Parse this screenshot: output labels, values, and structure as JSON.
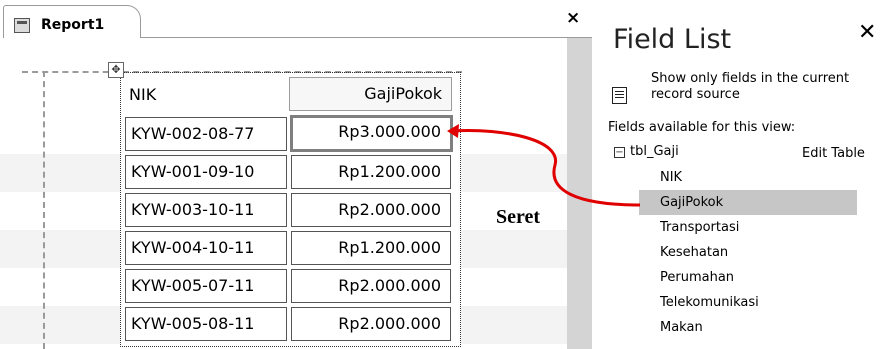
{
  "report_window": {
    "tab_label": "Report1",
    "close_glyph": "×",
    "move_handle_glyph": "✥",
    "columns": {
      "left_header": "NIK",
      "right_header": "GajiPokok"
    },
    "rows": [
      {
        "nik": "KYW-002-08-77",
        "gaji": "Rp3.000.000"
      },
      {
        "nik": "KYW-001-09-10",
        "gaji": "Rp1.200.000"
      },
      {
        "nik": "KYW-003-10-11",
        "gaji": "Rp2.000.000"
      },
      {
        "nik": "KYW-004-10-11",
        "gaji": "Rp1.200.000"
      },
      {
        "nik": "KYW-005-07-11",
        "gaji": "Rp2.000.000"
      },
      {
        "nik": "KYW-005-08-11",
        "gaji": "Rp2.000.000"
      }
    ]
  },
  "field_list": {
    "title": "Field List",
    "close_glyph": "✕",
    "show_only_text": "Show only fields in the current record source",
    "available_label": "Fields available for this view:",
    "tree_toggle": "⊟",
    "table_name": "tbl_Gaji",
    "edit_table": "Edit Table",
    "fields": [
      "NIK",
      "GajiPokok",
      "Transportasi",
      "Kesehatan",
      "Perumahan",
      "Telekomunikasi",
      "Makan"
    ],
    "selected_field": "GajiPokok"
  },
  "annotation": {
    "label": "Seret",
    "arrow_color": "#e00000"
  },
  "icons": {
    "report_tab": "report-icon",
    "show_only": "filter-list-icon",
    "move_handle": "move-icon"
  }
}
